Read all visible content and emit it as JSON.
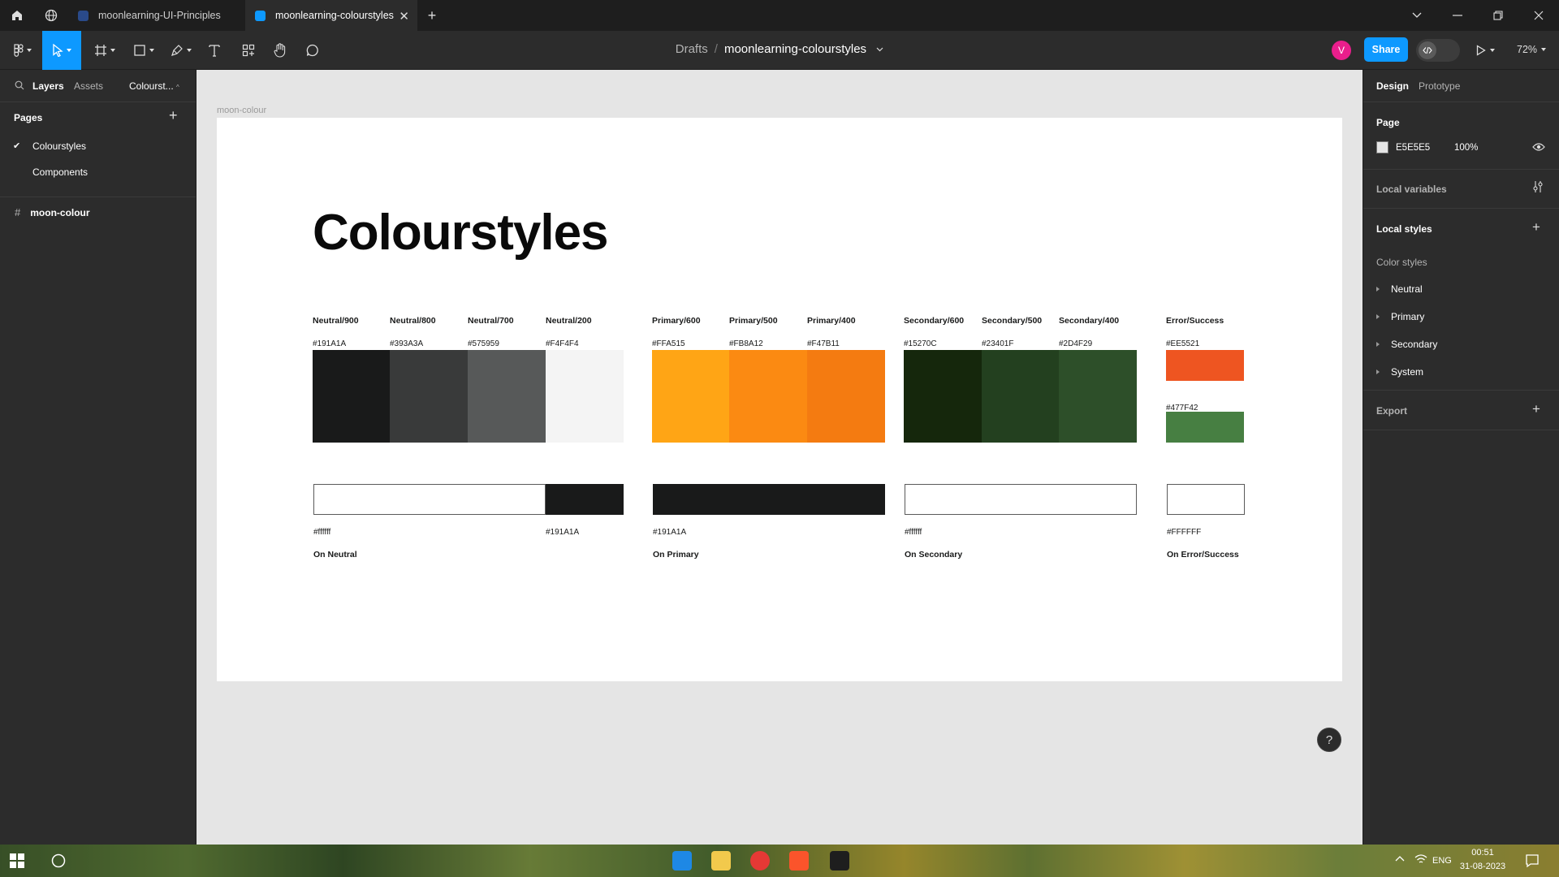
{
  "window": {
    "tabs": [
      {
        "label": "moonlearning-UI-Principles"
      },
      {
        "label": "moonlearning-colourstyles"
      }
    ]
  },
  "toolbar": {
    "breadcrumb_root": "Drafts",
    "file_name": "moonlearning-colourstyles",
    "avatar_initial": "V",
    "share_label": "Share",
    "zoom": "72%"
  },
  "left_panel": {
    "tabs": {
      "layers": "Layers",
      "assets": "Assets",
      "page": "Colourst..."
    },
    "pages_title": "Pages",
    "pages": [
      {
        "label": "Colourstyles",
        "checked": true
      },
      {
        "label": "Components",
        "checked": false
      }
    ],
    "layers": [
      {
        "label": "moon-colour"
      }
    ]
  },
  "canvas": {
    "frame_label": "moon-colour",
    "title": "Colourstyles",
    "swatches": [
      {
        "name": "Neutral/900",
        "hex": "#191A1A",
        "color": "#191A1A"
      },
      {
        "name": "Neutral/800",
        "hex": "#393A3A",
        "color": "#393A3A"
      },
      {
        "name": "Neutral/700",
        "hex": "#575959",
        "color": "#575959"
      },
      {
        "name": "Neutral/200",
        "hex": "#F4F4F4",
        "color": "#F4F4F4"
      },
      {
        "name": "Primary/600",
        "hex": "#FFA515",
        "color": "#FFA515"
      },
      {
        "name": "Primary/500",
        "hex": "#FB8A12",
        "color": "#FB8A12"
      },
      {
        "name": "Primary/400",
        "hex": "#F47B11",
        "color": "#F47B11"
      },
      {
        "name": "Secondary/600",
        "hex": "#15270C",
        "color": "#15270C"
      },
      {
        "name": "Secondary/500",
        "hex": "#23401F",
        "color": "#23401F"
      },
      {
        "name": "Secondary/400",
        "hex": "#2D4F29",
        "color": "#2D4F29"
      }
    ],
    "error_success": {
      "name": "Error/Success",
      "error_hex": "#EE5521",
      "error_color": "#EE5521",
      "success_hex": "#477F42",
      "success_color": "#477F42"
    },
    "on_colors": [
      {
        "label": "On Neutral",
        "hex1": "#ffffff",
        "hex2": "#191A1A"
      },
      {
        "label": "On Primary",
        "hex1": "#191A1A"
      },
      {
        "label": "On Secondary",
        "hex1": "#ffffff"
      },
      {
        "label": "On Error/Success",
        "hex1": "#FFFFFF"
      }
    ]
  },
  "right_panel": {
    "tabs": {
      "design": "Design",
      "prototype": "Prototype"
    },
    "page_section_title": "Page",
    "page_color": "E5E5E5",
    "page_opacity": "100%",
    "local_variables": "Local variables",
    "local_styles": "Local styles",
    "color_styles_label": "Color styles",
    "color_styles": [
      "Neutral",
      "Primary",
      "Secondary",
      "System"
    ],
    "export": "Export"
  },
  "taskbar": {
    "language": "ENG",
    "time": "00:51",
    "date": "31-08-2023"
  },
  "help": "?"
}
